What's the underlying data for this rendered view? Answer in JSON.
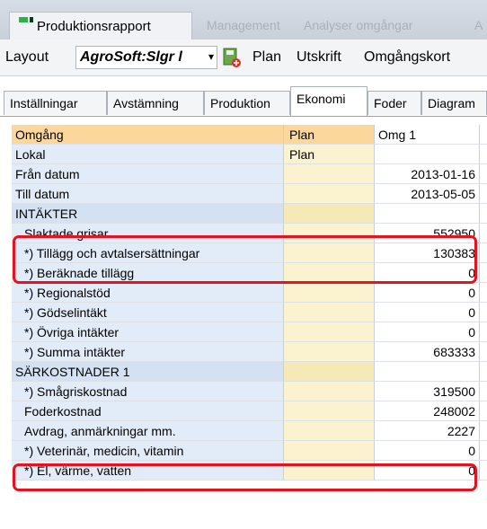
{
  "window": {
    "title": "Produktionsrapport",
    "ghost_tabs": [
      "Management",
      "Analyser omgångar",
      "A"
    ]
  },
  "toolbar": {
    "layout_label": "Layout",
    "layout_value": "AgroSoft:Slgr l",
    "plan": "Plan",
    "utskrift": "Utskrift",
    "omgangskort": "Omgångskort"
  },
  "tabs": [
    "Inställningar",
    "Avstämning",
    "Produktion",
    "Ekonomi",
    "Foder",
    "Diagram"
  ],
  "active_tab": "Ekonomi",
  "grid": {
    "rows": [
      {
        "label": "Omgång",
        "plan": "Plan",
        "value": "Omg 1",
        "kind": "header"
      },
      {
        "label": "Lokal",
        "plan": "Plan",
        "value": "",
        "kind": "info"
      },
      {
        "label": "Från datum",
        "plan": "",
        "value": "2013-01-16",
        "kind": "info",
        "num": true
      },
      {
        "label": "Till datum",
        "plan": "",
        "value": "2013-05-05",
        "kind": "info",
        "num": true
      },
      {
        "label": "INTÄKTER",
        "plan": "",
        "value": "",
        "kind": "section"
      },
      {
        "label": "Slaktade grisar",
        "plan": "",
        "value": "552950",
        "kind": "item",
        "num": true
      },
      {
        "label": "*) Tillägg och avtalsersättningar",
        "plan": "",
        "value": "130383",
        "kind": "item",
        "num": true
      },
      {
        "label": "*) Beräknade tillägg",
        "plan": "",
        "value": "0",
        "kind": "item",
        "num": true
      },
      {
        "label": "*) Regionalstöd",
        "plan": "",
        "value": "0",
        "kind": "item",
        "num": true
      },
      {
        "label": "*) Gödselintäkt",
        "plan": "",
        "value": "0",
        "kind": "item",
        "num": true
      },
      {
        "label": "*) Övriga intäkter",
        "plan": "",
        "value": "0",
        "kind": "item",
        "num": true
      },
      {
        "label": "*) Summa intäkter",
        "plan": "",
        "value": "683333",
        "kind": "item",
        "num": true
      },
      {
        "label": "SÄRKOSTNADER 1",
        "plan": "",
        "value": "",
        "kind": "section"
      },
      {
        "label": "*) Smågriskostnad",
        "plan": "",
        "value": "319500",
        "kind": "item",
        "num": true
      },
      {
        "label": "Foderkostnad",
        "plan": "",
        "value": "248002",
        "kind": "item",
        "num": true
      },
      {
        "label": "Avdrag, anmärkningar mm.",
        "plan": "",
        "value": "2227",
        "kind": "item",
        "num": true
      },
      {
        "label": "*) Veterinär, medicin, vitamin",
        "plan": "",
        "value": "0",
        "kind": "item",
        "num": true
      },
      {
        "label": "*) El, värme, vatten",
        "plan": "",
        "value": "0",
        "kind": "item",
        "num": true
      }
    ]
  },
  "colors": {
    "highlight": "#e8121e",
    "label_column": "#e2ecf8",
    "plan_column": "#fbf2cf",
    "header_row": "#fbd79b"
  }
}
